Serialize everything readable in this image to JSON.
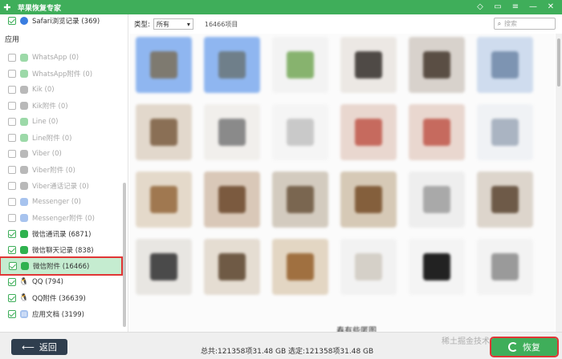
{
  "app": {
    "title": "苹果恢复专家"
  },
  "titlebar": {
    "icons": [
      "diamond-icon",
      "feedback-icon",
      "menu-icon",
      "minimize-icon",
      "close-icon"
    ]
  },
  "sidebar": {
    "top_item": {
      "label": "Safari浏览记录 (369)",
      "checked": true
    },
    "section_label": "应用",
    "items": [
      {
        "label": "WhatsApp (0)",
        "checked": false,
        "icon": "whatsapp-icon"
      },
      {
        "label": "WhatsApp附件 (0)",
        "checked": false,
        "icon": "whatsapp-icon"
      },
      {
        "label": "Kik (0)",
        "checked": false,
        "icon": "kik-icon"
      },
      {
        "label": "Kik附件 (0)",
        "checked": false,
        "icon": "kik-icon"
      },
      {
        "label": "Line (0)",
        "checked": false,
        "icon": "line-icon"
      },
      {
        "label": "Line附件 (0)",
        "checked": false,
        "icon": "line-icon"
      },
      {
        "label": "Viber (0)",
        "checked": false,
        "icon": "viber-icon"
      },
      {
        "label": "Viber附件 (0)",
        "checked": false,
        "icon": "viber-icon"
      },
      {
        "label": "Viber通话记录 (0)",
        "checked": false,
        "icon": "viber-icon"
      },
      {
        "label": "Messenger (0)",
        "checked": false,
        "icon": "messenger-icon"
      },
      {
        "label": "Messenger附件 (0)",
        "checked": false,
        "icon": "messenger-icon"
      },
      {
        "label": "微信通讯录 (6871)",
        "checked": true,
        "icon": "wechat-icon"
      },
      {
        "label": "微信聊天记录 (838)",
        "checked": true,
        "icon": "wechat-icon"
      },
      {
        "label": "微信附件 (16466)",
        "checked": true,
        "icon": "wechat-icon",
        "selected": true
      },
      {
        "label": "QQ (794)",
        "checked": true,
        "icon": "qq-icon"
      },
      {
        "label": "QQ附件 (36639)",
        "checked": true,
        "icon": "qq-icon"
      },
      {
        "label": "应用文档 (3199)",
        "checked": true,
        "icon": "document-icon"
      }
    ]
  },
  "toolbar": {
    "type_label": "类型:",
    "type_value": "所有",
    "count_label": "16466项目",
    "search_placeholder": "搜索"
  },
  "grid": {
    "caption": "春有些匿图"
  },
  "footer": {
    "back_label": "返回",
    "summary": "总共:121358项31.48 GB 选定:121358项31.48 GB",
    "recover_label": "恢复",
    "watermark": "稀土掘金技术社区"
  },
  "colors": {
    "brand": "#3fae5a",
    "back_button": "#2f3e4e",
    "highlight": "#e03535"
  }
}
